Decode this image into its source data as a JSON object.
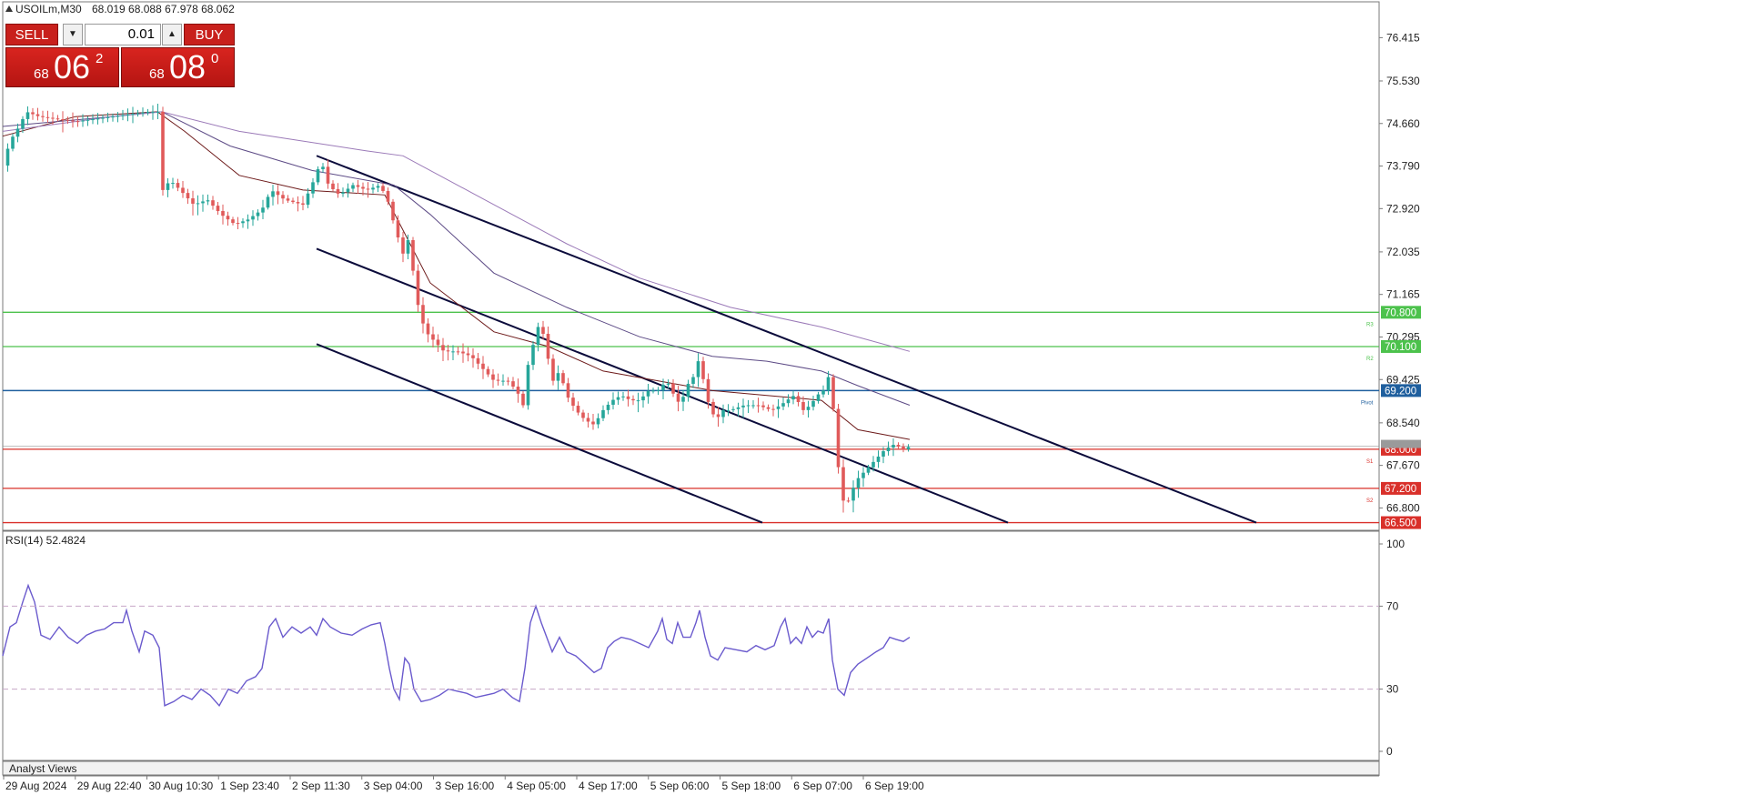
{
  "header": {
    "symbol_info": "USOILm,M30",
    "ohlc": "68.019 68.088 67.978 68.062"
  },
  "trade_panel": {
    "sell_label": "SELL",
    "buy_label": "BUY",
    "lot_value": "0.01",
    "sell_price_prefix": "68",
    "sell_price_main": "06",
    "sell_price_sup": "2",
    "buy_price_prefix": "68",
    "buy_price_main": "08",
    "buy_price_sup": "0"
  },
  "rsi_label": "RSI(14) 52.4824",
  "analyst_views_label": "Analyst Views",
  "colors": {
    "bull": "#26a69a",
    "bear": "#e05a5a",
    "resistance": "#4cc24c",
    "pivot": "#1f5f9e",
    "support": "#d9302a",
    "rsi": "#6a5acd",
    "channel": "#0b0b3b"
  },
  "chart_data": [
    {
      "type": "candlestick",
      "ylim": [
        66.38,
        76.85
      ],
      "price_axis_ticks": [
        "76.415",
        "75.530",
        "74.660",
        "73.790",
        "72.920",
        "72.035",
        "71.165",
        "70.295",
        "69.425",
        "68.540",
        "67.670",
        "66.800"
      ],
      "price_axis_tick_values": [
        76.415,
        75.53,
        74.66,
        73.79,
        72.92,
        72.035,
        71.165,
        70.295,
        69.425,
        68.54,
        67.67,
        66.8
      ],
      "x_tick_labels": [
        "29 Aug 2024",
        "29 Aug 22:40",
        "30 Aug 10:30",
        "1 Sep 23:40",
        "2 Sep 11:30",
        "3 Sep 04:00",
        "3 Sep 16:00",
        "4 Sep 05:00",
        "4 Sep 17:00",
        "5 Sep 06:00",
        "5 Sep 18:00",
        "6 Sep 07:00",
        "6 Sep 19:00"
      ],
      "close_path": [
        [
          0,
          73.8
        ],
        [
          8,
          74.3
        ],
        [
          18,
          74.6
        ],
        [
          26,
          74.9
        ],
        [
          40,
          74.8
        ],
        [
          80,
          74.7
        ],
        [
          120,
          74.8
        ],
        [
          160,
          74.9
        ],
        [
          175,
          74.9
        ],
        [
          176,
          73.3
        ],
        [
          184,
          73.5
        ],
        [
          195,
          73.3
        ],
        [
          210,
          73.0
        ],
        [
          225,
          73.1
        ],
        [
          240,
          72.8
        ],
        [
          255,
          72.6
        ],
        [
          270,
          72.7
        ],
        [
          285,
          72.9
        ],
        [
          295,
          73.3
        ],
        [
          310,
          73.1
        ],
        [
          330,
          73.0
        ],
        [
          342,
          73.5
        ],
        [
          350,
          73.9
        ],
        [
          358,
          73.4
        ],
        [
          370,
          73.2
        ],
        [
          385,
          73.4
        ],
        [
          400,
          73.3
        ],
        [
          415,
          73.4
        ],
        [
          425,
          73.0
        ],
        [
          430,
          72.6
        ],
        [
          440,
          72.0
        ],
        [
          448,
          72.4
        ],
        [
          452,
          71.4
        ],
        [
          458,
          70.8
        ],
        [
          465,
          70.4
        ],
        [
          475,
          70.2
        ],
        [
          485,
          70.0
        ],
        [
          500,
          70.0
        ],
        [
          515,
          69.9
        ],
        [
          525,
          69.7
        ],
        [
          540,
          69.4
        ],
        [
          555,
          69.4
        ],
        [
          565,
          69.2
        ],
        [
          572,
          68.9
        ],
        [
          578,
          69.8
        ],
        [
          584,
          70.2
        ],
        [
          590,
          70.6
        ],
        [
          595,
          70.3
        ],
        [
          600,
          69.8
        ],
        [
          605,
          69.4
        ],
        [
          612,
          69.6
        ],
        [
          620,
          69.1
        ],
        [
          630,
          68.8
        ],
        [
          640,
          68.6
        ],
        [
          650,
          68.5
        ],
        [
          660,
          68.8
        ],
        [
          670,
          69.0
        ],
        [
          680,
          69.1
        ],
        [
          690,
          69.0
        ],
        [
          700,
          69.0
        ],
        [
          710,
          69.2
        ],
        [
          720,
          69.2
        ],
        [
          730,
          69.4
        ],
        [
          738,
          69.1
        ],
        [
          745,
          68.9
        ],
        [
          752,
          69.3
        ],
        [
          760,
          69.5
        ],
        [
          766,
          69.9
        ],
        [
          772,
          69.2
        ],
        [
          778,
          68.8
        ],
        [
          785,
          68.6
        ],
        [
          790,
          68.8
        ],
        [
          800,
          68.8
        ],
        [
          815,
          68.9
        ],
        [
          830,
          68.9
        ],
        [
          845,
          68.8
        ],
        [
          855,
          68.9
        ],
        [
          862,
          69.0
        ],
        [
          870,
          69.1
        ],
        [
          880,
          68.8
        ],
        [
          888,
          68.9
        ],
        [
          895,
          69.1
        ],
        [
          902,
          69.2
        ],
        [
          908,
          69.5
        ],
        [
          912,
          69.0
        ],
        [
          916,
          68.3
        ],
        [
          919,
          67.5
        ],
        [
          923,
          67.0
        ],
        [
          927,
          66.8
        ],
        [
          932,
          67.1
        ],
        [
          940,
          67.4
        ],
        [
          950,
          67.6
        ],
        [
          960,
          67.8
        ],
        [
          970,
          68.0
        ],
        [
          980,
          68.1
        ],
        [
          990,
          68.0
        ],
        [
          997,
          68.06
        ]
      ],
      "moving_averages": [
        {
          "color": "#6e1b1b",
          "points": [
            [
              0,
              74.4
            ],
            [
              80,
              74.8
            ],
            [
              170,
              74.9
            ],
            [
              200,
              74.5
            ],
            [
              260,
              73.6
            ],
            [
              330,
              73.3
            ],
            [
              420,
              73.2
            ],
            [
              470,
              71.4
            ],
            [
              540,
              70.4
            ],
            [
              600,
              70.1
            ],
            [
              660,
              69.6
            ],
            [
              720,
              69.4
            ],
            [
              780,
              69.2
            ],
            [
              840,
              69.1
            ],
            [
              900,
              69.0
            ],
            [
              940,
              68.4
            ],
            [
              997,
              68.2
            ]
          ]
        },
        {
          "color": "#5d4b86",
          "points": [
            [
              0,
              74.6
            ],
            [
              120,
              74.8
            ],
            [
              175,
              74.9
            ],
            [
              250,
              74.2
            ],
            [
              340,
              73.7
            ],
            [
              430,
              73.4
            ],
            [
              470,
              72.8
            ],
            [
              540,
              71.6
            ],
            [
              620,
              70.9
            ],
            [
              700,
              70.3
            ],
            [
              780,
              69.9
            ],
            [
              840,
              69.8
            ],
            [
              900,
              69.6
            ],
            [
              940,
              69.3
            ],
            [
              997,
              68.9
            ]
          ]
        },
        {
          "color": "#9b7ab8",
          "points": [
            [
              0,
              74.5
            ],
            [
              120,
              74.8
            ],
            [
              175,
              74.9
            ],
            [
              260,
              74.5
            ],
            [
              400,
              74.1
            ],
            [
              440,
              74.0
            ],
            [
              520,
              73.2
            ],
            [
              620,
              72.2
            ],
            [
              700,
              71.5
            ],
            [
              800,
              70.9
            ],
            [
              900,
              70.5
            ],
            [
              997,
              70.0
            ]
          ]
        }
      ],
      "channel_lines": [
        {
          "start": [
            345,
            74.0
          ],
          "end": [
            1378,
            66.5
          ]
        },
        {
          "start": [
            345,
            72.1
          ],
          "end": [
            1105,
            66.5
          ]
        },
        {
          "start": [
            345,
            70.15
          ],
          "end": [
            835,
            66.5
          ]
        }
      ],
      "levels": [
        {
          "label": "70.800",
          "value": 70.8,
          "role": "resistance",
          "tag": "R3"
        },
        {
          "label": "70.100",
          "value": 70.1,
          "role": "resistance",
          "tag": "R2"
        },
        {
          "label": "69.200",
          "value": 69.2,
          "role": "pivot",
          "tag": "Pivot"
        },
        {
          "label": "68.000",
          "value": 68.0,
          "role": "support",
          "tag": "S1"
        },
        {
          "label": "67.200",
          "value": 67.2,
          "role": "support",
          "tag": "S2"
        },
        {
          "label": "66.500",
          "value": 66.5,
          "role": "support",
          "tag": ""
        }
      ],
      "last_price": {
        "value": 68.062,
        "label": "68.062"
      }
    },
    {
      "type": "line",
      "title": "RSI(14) 52.4824",
      "ylim": [
        0,
        100
      ],
      "y_ticks": [
        100,
        70,
        30,
        0
      ],
      "levels": [
        70,
        30
      ],
      "series": [
        {
          "points": [
            [
              0,
              46
            ],
            [
              8,
              60
            ],
            [
              15,
              62
            ],
            [
              22,
              72
            ],
            [
              28,
              80
            ],
            [
              35,
              72
            ],
            [
              42,
              56
            ],
            [
              52,
              54
            ],
            [
              62,
              60
            ],
            [
              72,
              55
            ],
            [
              82,
              52
            ],
            [
              92,
              56
            ],
            [
              102,
              58
            ],
            [
              112,
              59
            ],
            [
              122,
              62
            ],
            [
              132,
              62
            ],
            [
              136,
              68
            ],
            [
              142,
              58
            ],
            [
              150,
              48
            ],
            [
              156,
              58
            ],
            [
              165,
              56
            ],
            [
              172,
              50
            ],
            [
              178,
              22
            ],
            [
              188,
              24
            ],
            [
              198,
              27
            ],
            [
              208,
              25
            ],
            [
              218,
              30
            ],
            [
              228,
              27
            ],
            [
              238,
              22
            ],
            [
              248,
              30
            ],
            [
              258,
              28
            ],
            [
              268,
              34
            ],
            [
              278,
              36
            ],
            [
              285,
              40
            ],
            [
              293,
              60
            ],
            [
              300,
              64
            ],
            [
              308,
              55
            ],
            [
              318,
              60
            ],
            [
              328,
              57
            ],
            [
              338,
              60
            ],
            [
              345,
              56
            ],
            [
              352,
              64
            ],
            [
              360,
              60
            ],
            [
              372,
              57
            ],
            [
              384,
              56
            ],
            [
              395,
              59
            ],
            [
              405,
              61
            ],
            [
              415,
              62
            ],
            [
              420,
              52
            ],
            [
              425,
              40
            ],
            [
              430,
              30
            ],
            [
              436,
              25
            ],
            [
              442,
              45
            ],
            [
              447,
              42
            ],
            [
              452,
              30
            ],
            [
              460,
              24
            ],
            [
              470,
              25
            ],
            [
              480,
              27
            ],
            [
              490,
              30
            ],
            [
              500,
              29
            ],
            [
              510,
              28
            ],
            [
              520,
              26
            ],
            [
              530,
              27
            ],
            [
              540,
              28
            ],
            [
              550,
              30
            ],
            [
              560,
              26
            ],
            [
              568,
              24
            ],
            [
              574,
              40
            ],
            [
              580,
              62
            ],
            [
              586,
              70
            ],
            [
              592,
              62
            ],
            [
              598,
              55
            ],
            [
              604,
              48
            ],
            [
              612,
              55
            ],
            [
              620,
              48
            ],
            [
              630,
              46
            ],
            [
              640,
              42
            ],
            [
              650,
              38
            ],
            [
              658,
              40
            ],
            [
              665,
              50
            ],
            [
              672,
              53
            ],
            [
              680,
              55
            ],
            [
              690,
              54
            ],
            [
              700,
              52
            ],
            [
              710,
              50
            ],
            [
              720,
              58
            ],
            [
              725,
              64
            ],
            [
              730,
              54
            ],
            [
              736,
              52
            ],
            [
              742,
              62
            ],
            [
              748,
              55
            ],
            [
              756,
              55
            ],
            [
              762,
              62
            ],
            [
              766,
              68
            ],
            [
              772,
              55
            ],
            [
              778,
              46
            ],
            [
              786,
              44
            ],
            [
              794,
              50
            ],
            [
              806,
              49
            ],
            [
              818,
              48
            ],
            [
              828,
              51
            ],
            [
              838,
              49
            ],
            [
              848,
              51
            ],
            [
              855,
              60
            ],
            [
              860,
              64
            ],
            [
              866,
              52
            ],
            [
              872,
              55
            ],
            [
              878,
              52
            ],
            [
              884,
              60
            ],
            [
              890,
              55
            ],
            [
              896,
              58
            ],
            [
              902,
              57
            ],
            [
              908,
              64
            ],
            [
              912,
              44
            ],
            [
              918,
              30
            ],
            [
              925,
              27
            ],
            [
              932,
              38
            ],
            [
              940,
              42
            ],
            [
              950,
              45
            ],
            [
              960,
              48
            ],
            [
              968,
              50
            ],
            [
              975,
              55
            ],
            [
              982,
              54
            ],
            [
              990,
              53
            ],
            [
              997,
              55
            ]
          ]
        }
      ]
    }
  ]
}
